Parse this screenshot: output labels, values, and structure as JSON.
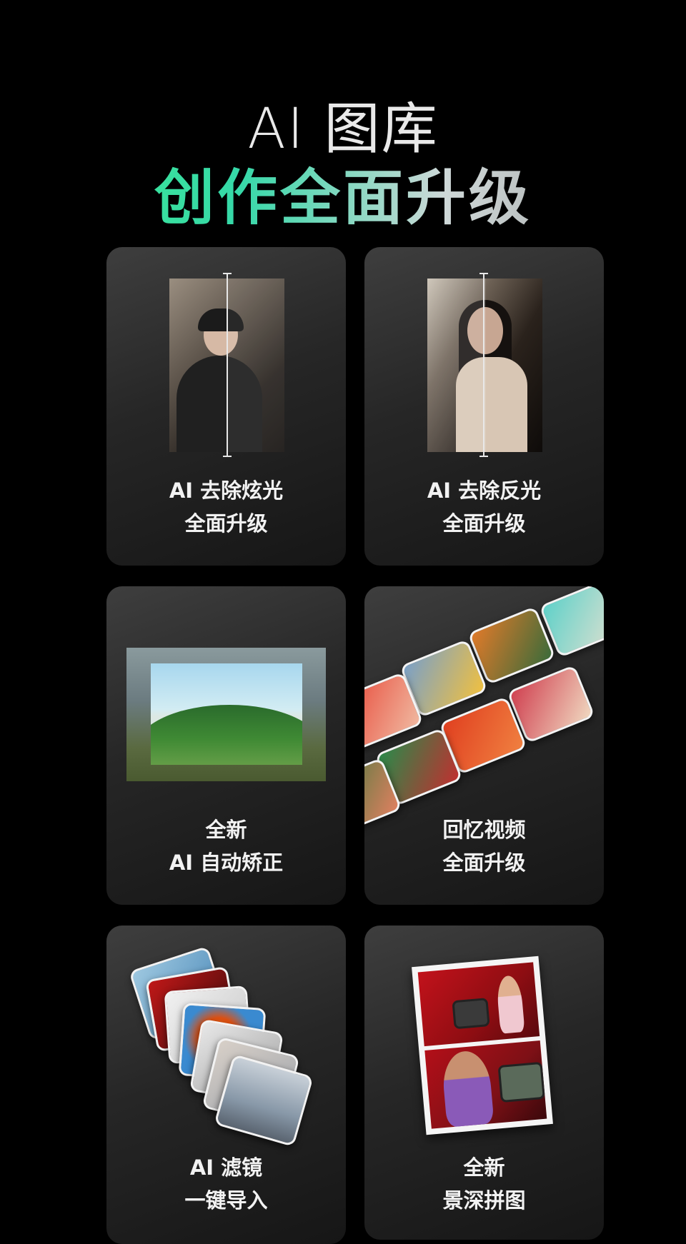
{
  "header": {
    "title": "AI 图库",
    "subtitle": "创作全面升级"
  },
  "cards": [
    {
      "line1": "AI 去除炫光",
      "line2": "全面升级"
    },
    {
      "line1": "AI 去除反光",
      "line2": "全面升级"
    },
    {
      "line1": "全新",
      "line2": "AI 自动矫正"
    },
    {
      "line1": "回忆视频",
      "line2": "全面升级"
    },
    {
      "line1": "AI 滤镜",
      "line2": "一键导入"
    },
    {
      "line1": "全新",
      "line2": "景深拼图"
    }
  ]
}
